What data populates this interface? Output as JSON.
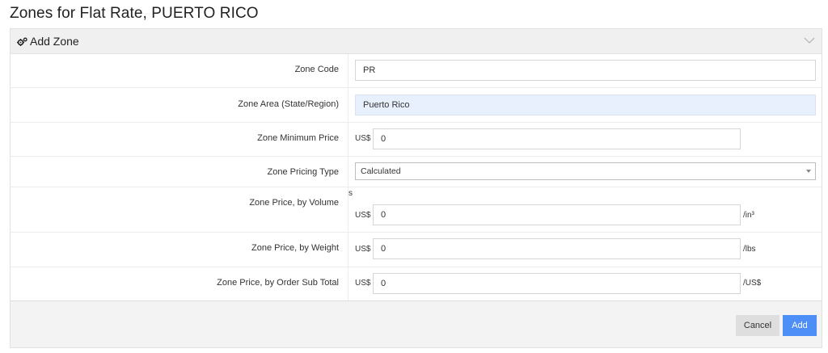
{
  "page": {
    "title": "Zones for Flat Rate, PUERTO RICO"
  },
  "panel": {
    "title": "Add Zone",
    "header_icon": "gears-icon",
    "collapse_icon": "chevron-down-icon"
  },
  "form": {
    "zone_code": {
      "label": "Zone Code",
      "value": "PR"
    },
    "zone_area": {
      "label": "Zone Area (State/Region)",
      "value": "Puerto Rico"
    },
    "zone_min_price": {
      "label": "Zone Minimum Price",
      "prefix": "US$",
      "value": "0"
    },
    "zone_pricing_type": {
      "label": "Zone Pricing Type",
      "selected": "Calculated"
    },
    "zone_price_volume": {
      "label": "Zone Price, by Volume",
      "stray_text": "s",
      "prefix": "US$",
      "value": "0",
      "suffix": "/in³"
    },
    "zone_price_weight": {
      "label": "Zone Price, by Weight",
      "prefix": "US$",
      "value": "0",
      "suffix": "/lbs"
    },
    "zone_price_subtotal": {
      "label": "Zone Price, by Order Sub Total",
      "prefix": "US$",
      "value": "0",
      "suffix": "/US$"
    }
  },
  "actions": {
    "cancel_label": "Cancel",
    "add_label": "Add"
  },
  "colors": {
    "primary": "#4e8ef7",
    "highlight_input": "#e8f0fe",
    "header_bg": "#f0f0f0"
  }
}
